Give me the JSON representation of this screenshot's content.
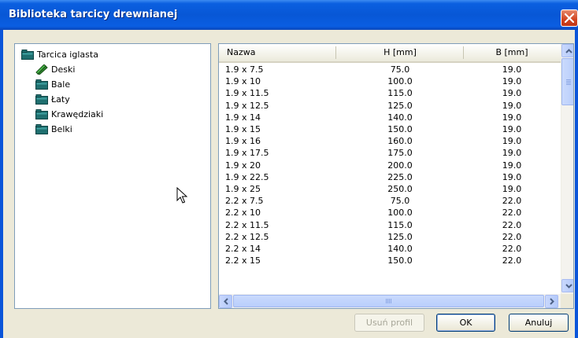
{
  "window": {
    "title": "Biblioteka tarcicy drewnianej",
    "accent_color": "#0a5fe0",
    "close_color": "#d1431f"
  },
  "tree": {
    "root": {
      "label": "Tarcica iglasta",
      "icon": "folder-icon"
    },
    "children": [
      {
        "label": "Deski",
        "icon": "board-icon"
      },
      {
        "label": "Bale",
        "icon": "folder-icon"
      },
      {
        "label": "Łaty",
        "icon": "folder-icon"
      },
      {
        "label": "Krawędziaki",
        "icon": "folder-icon"
      },
      {
        "label": "Belki",
        "icon": "folder-icon"
      }
    ]
  },
  "table": {
    "columns": [
      "Nazwa",
      "H [mm]",
      "B [mm]"
    ],
    "rows": [
      [
        "1.9 x 7.5",
        "75.0",
        "19.0"
      ],
      [
        "1.9 x 10",
        "100.0",
        "19.0"
      ],
      [
        "1.9 x 11.5",
        "115.0",
        "19.0"
      ],
      [
        "1.9 x 12.5",
        "125.0",
        "19.0"
      ],
      [
        "1.9 x 14",
        "140.0",
        "19.0"
      ],
      [
        "1.9 x 15",
        "150.0",
        "19.0"
      ],
      [
        "1.9 x 16",
        "160.0",
        "19.0"
      ],
      [
        "1.9 x 17.5",
        "175.0",
        "19.0"
      ],
      [
        "1.9 x 20",
        "200.0",
        "19.0"
      ],
      [
        "1.9 x 22.5",
        "225.0",
        "19.0"
      ],
      [
        "1.9 x 25",
        "250.0",
        "19.0"
      ],
      [
        "2.2 x 7.5",
        "75.0",
        "22.0"
      ],
      [
        "2.2 x 10",
        "100.0",
        "22.0"
      ],
      [
        "2.2 x 11.5",
        "115.0",
        "22.0"
      ],
      [
        "2.2 x 12.5",
        "125.0",
        "22.0"
      ],
      [
        "2.2 x 14",
        "140.0",
        "22.0"
      ],
      [
        "2.2 x 15",
        "150.0",
        "22.0"
      ]
    ]
  },
  "buttons": {
    "remove_profile": "Usuń profil",
    "ok": "OK",
    "cancel": "Anuluj"
  }
}
